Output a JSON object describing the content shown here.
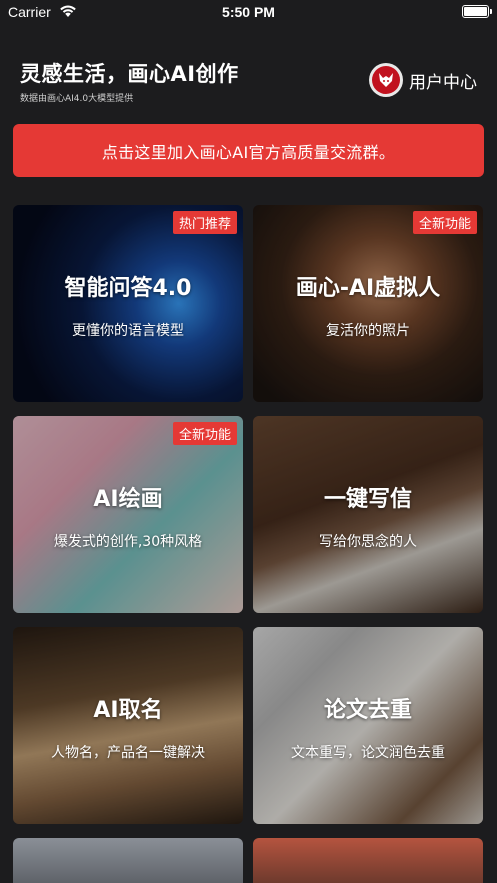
{
  "status_bar": {
    "carrier": "Carrier",
    "time": "5:50 PM"
  },
  "header": {
    "title": "灵感生活，画心AI创作",
    "subtitle": "数据由画心AI4.0大模型提供",
    "user_center_label": "用户中心"
  },
  "banner": {
    "label": "点击这里加入画心AI官方高质量交流群。"
  },
  "cards": [
    {
      "title": "智能问答4.0",
      "desc": "更懂你的语言模型",
      "badge": "热门推荐"
    },
    {
      "title": "画心-AI虚拟人",
      "desc": "复活你的照片",
      "badge": "全新功能"
    },
    {
      "title": "AI绘画",
      "desc": "爆发式的创作,30种风格",
      "badge": "全新功能"
    },
    {
      "title": "一键写信",
      "desc": "写给你思念的人"
    },
    {
      "title": "AI取名",
      "desc": "人物名，产品名一键解决"
    },
    {
      "title": "论文去重",
      "desc": "文本重写，论文润色去重"
    }
  ],
  "colors": {
    "accent": "#e53935",
    "background": "#1c1c1e"
  }
}
